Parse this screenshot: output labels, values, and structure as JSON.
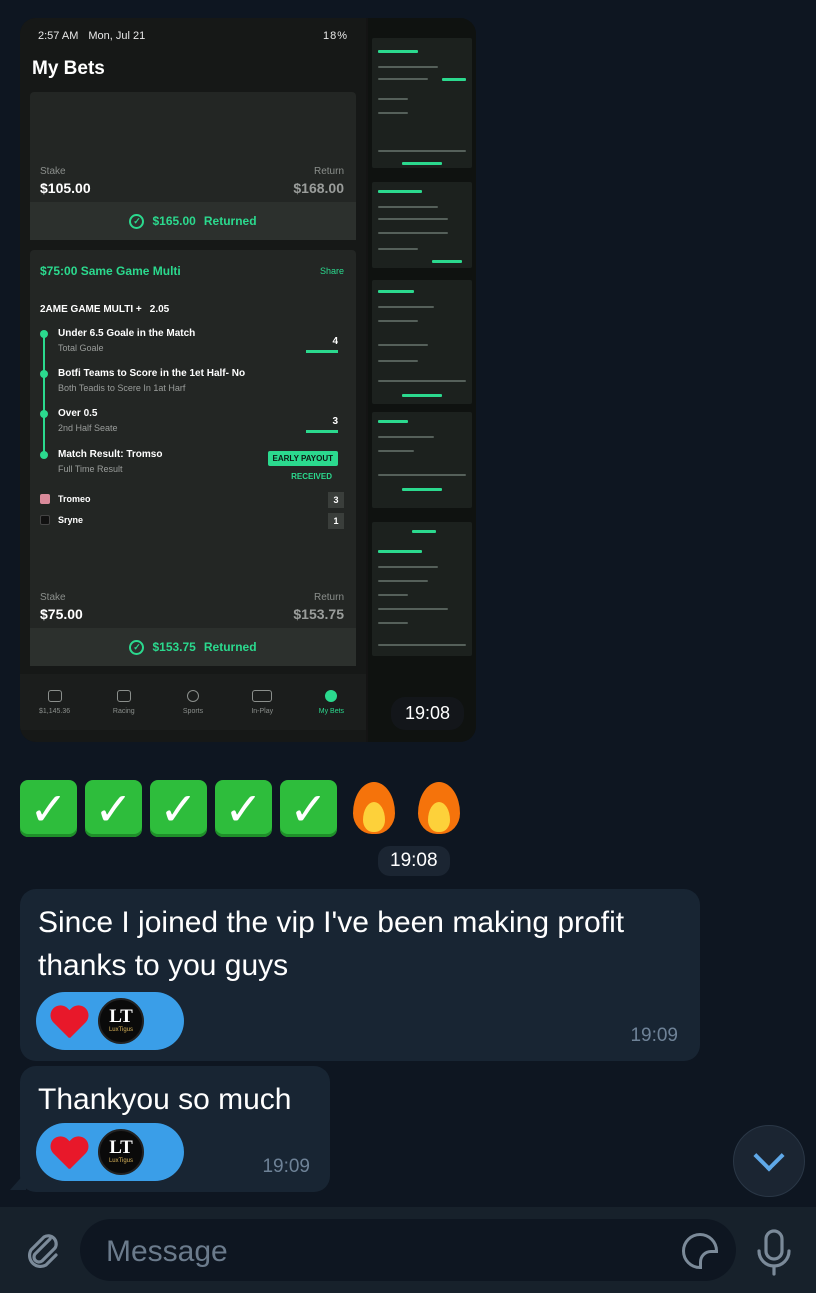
{
  "album": {
    "time": "19:08",
    "phone": {
      "status_time": "2:57 AM",
      "status_date": "Mon, Jul 21",
      "battery": "18%",
      "title": "My Bets",
      "card1": {
        "stake_label": "Stake",
        "stake_value": "$105.00",
        "return_label": "Return",
        "return_value": "$168.00",
        "returned_amount": "$165.00",
        "returned_label": "Returned"
      },
      "card2": {
        "heading": "$75:00 Same Game Multi",
        "share": "Share",
        "sgm_label": "2AME GAME MULTI +",
        "sgm_odds": "2.05",
        "legs": [
          {
            "title": "Under 6.5 Goale in the Match",
            "sub": "Total Goale",
            "count": "4"
          },
          {
            "title": "Botfi Teams to Score in the 1et Half- No",
            "sub": "Both Teadis to Scere In 1at Harf",
            "count": ""
          },
          {
            "title": "Over 0.5",
            "sub": "2nd Half Seate",
            "count": "3"
          },
          {
            "title": "Match Result: Tromso",
            "sub": "Full Time Result",
            "count": ""
          }
        ],
        "early_payout": "EARLY PAYOUT",
        "received": "RECEIVED",
        "teams": [
          {
            "name": "Tromeo",
            "score": "3"
          },
          {
            "name": "Sryne",
            "score": "1"
          }
        ],
        "stake_label": "Stake",
        "stake_value": "$75.00",
        "return_label": "Return",
        "return_value": "$153.75",
        "returned_amount": "$153.75",
        "returned_label": "Returned"
      },
      "nav": [
        {
          "label": "$1,145.36"
        },
        {
          "label": "Racing"
        },
        {
          "label": "Sports"
        },
        {
          "label": "In-Play"
        },
        {
          "label": "My Bets"
        }
      ]
    }
  },
  "emoji_message": {
    "checks": [
      "✓",
      "✓",
      "✓",
      "✓",
      "✓"
    ],
    "time": "19:08"
  },
  "messages": [
    {
      "text": "Since I joined the vip I've been making profit thanks to you guys",
      "time": "19:09",
      "avatar_text": "LT",
      "avatar_sub": "LuxTigus"
    },
    {
      "text": "Thankyou so much",
      "time": "19:09",
      "avatar_text": "LT",
      "avatar_sub": "LuxTigus"
    }
  ],
  "composer": {
    "placeholder": "Message"
  },
  "colors": {
    "background": "#0e1621",
    "bubble": "#182533",
    "accent": "#2bd98e",
    "reaction": "#3a9ee8"
  }
}
